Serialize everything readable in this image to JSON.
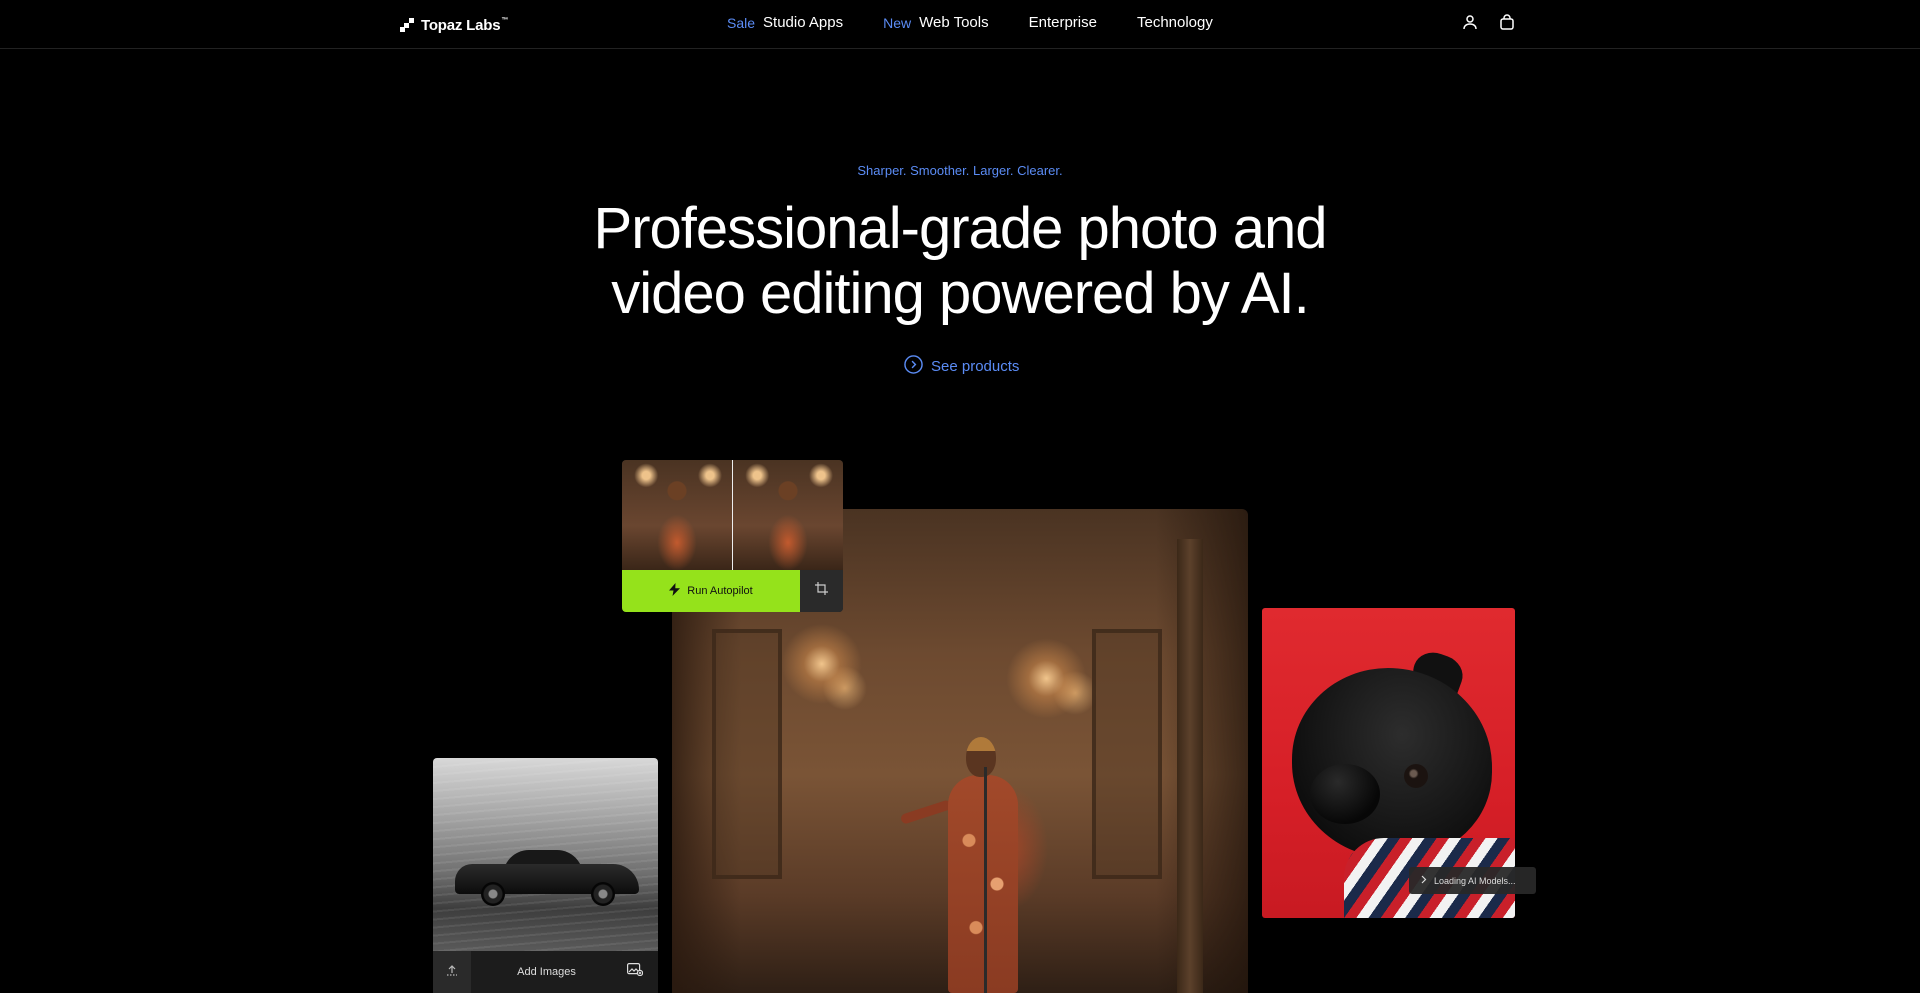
{
  "brand": {
    "name": "Topaz Labs",
    "trademark": "™"
  },
  "nav": {
    "links": [
      {
        "badge": "Sale",
        "label": "Studio Apps"
      },
      {
        "badge": "New",
        "label": "Web Tools"
      },
      {
        "badge": "",
        "label": "Enterprise"
      },
      {
        "badge": "",
        "label": "Technology"
      }
    ],
    "icons": [
      "user-icon",
      "shopping-bag-icon"
    ]
  },
  "hero": {
    "eyebrow": "Sharper. Smoother. Larger. Clearer.",
    "headline_line1": "Professional-grade photo and",
    "headline_line2": "video editing powered by AI.",
    "cta": "See products"
  },
  "autopilot": {
    "run_label": "Run Autopilot",
    "icons": [
      "lightning-icon",
      "crop-icon"
    ]
  },
  "car_card": {
    "add_label": "Add Images",
    "icons": [
      "upload-icon",
      "image-add-icon"
    ]
  },
  "pug_card": {
    "status": "Loading AI Models...",
    "icon": "chevron-right-icon"
  },
  "colors": {
    "background": "#000000",
    "accent_blue": "#5b8cf5",
    "autopilot_green": "#95e21b",
    "pug_red": "#d61f27"
  }
}
